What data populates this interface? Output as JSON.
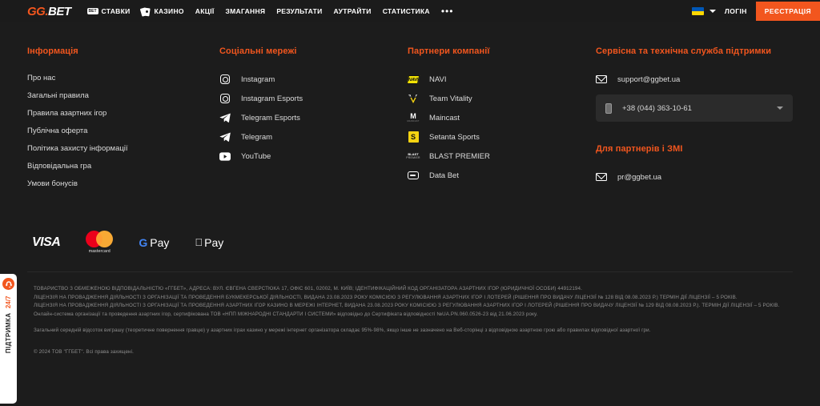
{
  "brand": {
    "logo_gg": "GG",
    "logo_dot": ".",
    "logo_bet": "BET",
    "accent": "#f2561e"
  },
  "nav": {
    "items": [
      {
        "label": "СТАВКИ",
        "icon": "bet-badge-icon"
      },
      {
        "label": "КАЗИНО",
        "icon": "playing-cards-icon"
      },
      {
        "label": "АКЦІЇ",
        "icon": ""
      },
      {
        "label": "ЗМАГАННЯ",
        "icon": ""
      },
      {
        "label": "РЕЗУЛЬТАТИ",
        "icon": ""
      },
      {
        "label": "АУТРАЙТИ",
        "icon": ""
      },
      {
        "label": "СТАТИСТИКА",
        "icon": ""
      }
    ],
    "overflow": "•••",
    "bet_badge": "BET",
    "login_label": "ЛОГІН",
    "register_label": "РЕЄСТРАЦІЯ",
    "language": "Ukrainian"
  },
  "footer": {
    "info": {
      "heading": "Інформація",
      "links": [
        "Про нас",
        "Загальні правила",
        "Правила азартних ігор",
        "Публічна оферта",
        "Політика захисту інформації",
        "Відповідальна гра",
        "Умови бонусів"
      ]
    },
    "social": {
      "heading": "Соціальні мережі",
      "items": [
        {
          "label": "Instagram",
          "icon": "instagram-icon"
        },
        {
          "label": "Instagram Esports",
          "icon": "instagram-icon"
        },
        {
          "label": "Telegram Esports",
          "icon": "telegram-icon"
        },
        {
          "label": "Telegram",
          "icon": "telegram-icon"
        },
        {
          "label": "YouTube",
          "icon": "youtube-icon"
        }
      ]
    },
    "partners": {
      "heading": "Партнери компанії",
      "items": [
        {
          "label": "NAVI",
          "icon": "navi-logo",
          "mark": "NAVI"
        },
        {
          "label": "Team Vitality",
          "icon": "team-vitality-logo",
          "mark": ""
        },
        {
          "label": "Maincast",
          "icon": "maincast-logo",
          "mark": "M",
          "sub": "MAINCAST"
        },
        {
          "label": "Setanta Sports",
          "icon": "setanta-logo",
          "mark": "S"
        },
        {
          "label": "BLAST PREMIER",
          "icon": "blast-premier-logo",
          "mark": "BLAST",
          "sub": "PREMIER"
        },
        {
          "label": "Data Bet",
          "icon": "databet-logo",
          "mark": ""
        }
      ]
    },
    "support": {
      "heading": "Сервісна та технічна служба підтримки",
      "email": "support@ggbet.ua",
      "phone": "+38 (044) 363-10-61",
      "partners_heading": "Для партнерів і ЗМІ",
      "partners_email": "pr@ggbet.ua"
    }
  },
  "payments": [
    {
      "name": "visa",
      "label": "VISA"
    },
    {
      "name": "mastercard",
      "label": "mastercard"
    },
    {
      "name": "google-pay",
      "g": "G",
      "label": "Pay"
    },
    {
      "name": "apple-pay",
      "apple": "",
      "label": "Pay"
    }
  ],
  "legal": {
    "p1": "ТОВАРИСТВО З ОБМЕЖЕНОЮ ВІДПОВІДАЛЬНІСТЮ «ГГБЕТ», АДРЕСА: ВУЛ. ЄВГЕНА СВЕРСТЮКА 17, ОФІС 601, 02002, М. КИЇВ; ІДЕНТИФІКАЦІЙНИЙ КОД ОРГАНІЗАТОРА АЗАРТНИХ ІГОР (ЮРИДИЧНОЇ ОСОБИ) 44912194.",
    "p2": "ЛІЦЕНЗІЯ НА ПРОВАДЖЕННЯ ДІЯЛЬНОСТІ З ОРГАНІЗАЦІЇ ТА ПРОВЕДЕННЯ БУКМЕКЕРСЬКОЇ ДІЯЛЬНОСТІ, ВИДАНА 23.08.2023 РОКУ КОМІСІЄЮ З РЕГУЛЮВАННЯ АЗАРТНИХ ІГОР І ЛОТЕРЕЙ (РІШЕННЯ ПРО ВИДАЧУ ЛІЦЕНЗІЇ № 128 ВІД 08.08.2023 Р.) Термін дії ліцензії – 5 років.",
    "p3": "ЛІЦЕНЗІЯ НА ПРОВАДЖЕННЯ ДІЯЛЬНОСТІ З ОРГАНІЗАЦІЇ ТА ПРОВЕДЕННЯ АЗАРТНИХ ІГОР КАЗИНО В МЕРЕЖІ ІНТЕРНЕТ, ВИДАНА 23.08.2023 РОКУ КОМІСІЄЮ З РЕГУЛЮВАННЯ АЗАРТНИХ ІГОР І ЛОТЕРЕЙ (РІШЕННЯ ПРО ВИДАЧУ ЛІЦЕНЗІЇ № 129 ВІД 08.08.2023 Р.). Термін дії ліцензії – 5 років.",
    "p4": "Онлайн-система організації та проведення азартних ігор, сертифікована ТОВ «НПП МІЖНАРОДНІ СТАНДАРТИ І СИСТЕМИ» відповідно до Сертифіката відповідності №UA.PN.060.0526-23 від 21.06.2023 року.",
    "p5": "Загальний середній відсоток виграшу (теоретичне повернення гравцю) у азартних іграх казино у мережі інтернет організатора складає 95%-98%, якщо інше не зазначено на Веб-сторінці з відповідною азартною грою або правилах відповідної азартної гри.",
    "copyright": "© 2024 ТОВ \"ГГБЕТ\". Всі права захищені."
  },
  "support_widget": {
    "label": "ПІДТРИМКА",
    "hours": "24/7",
    "icon": "headset-icon"
  }
}
